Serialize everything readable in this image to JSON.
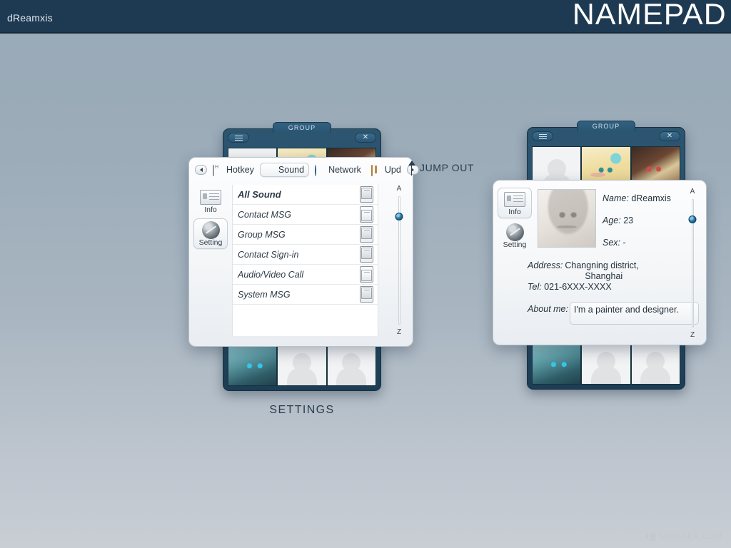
{
  "header": {
    "user": "dReamxis",
    "brand": "NAMEPAD"
  },
  "group_window_left": {
    "tab_label": "GROUP",
    "menu_icon": "hamburger-icon",
    "close_icon": "close-icon",
    "top_avatars": [
      "placeholder-avatar",
      "blonde-anime-avatar",
      "red-eyes-anime-avatar"
    ],
    "bottom_avatars": [
      "teal-hair-anime-avatar",
      "placeholder-avatar",
      "placeholder-avatar"
    ]
  },
  "group_window_right": {
    "tab_label": "GROUP",
    "menu_icon": "hamburger-icon",
    "close_icon": "close-icon",
    "top_avatars": [
      "placeholder-avatar",
      "blonde-anime-avatar",
      "red-eyes-anime-avatar"
    ],
    "bottom_avatars": [
      "teal-hair-anime-avatar",
      "placeholder-avatar",
      "placeholder-avatar"
    ]
  },
  "settings_panel": {
    "tabs": [
      {
        "label": "Hotkey",
        "icon": "keyboard-key-icon",
        "selected": false
      },
      {
        "label": "Sound",
        "icon": "speaker-icon",
        "selected": true
      },
      {
        "label": "Network",
        "icon": "globe-icon",
        "selected": false
      },
      {
        "label": "Upd",
        "icon": "package-box-icon",
        "selected": false
      }
    ],
    "scroll_left_icon": "arrow-left-icon",
    "scroll_right_icon": "arrow-right-icon",
    "sidebar": [
      {
        "label": "Info",
        "icon": "id-card-icon",
        "selected": false
      },
      {
        "label": "Setting",
        "icon": "gear-icon",
        "selected": true
      }
    ],
    "sound_rows": [
      {
        "label": "All Sound",
        "state": "on"
      },
      {
        "label": "Contact MSG",
        "state": "off"
      },
      {
        "label": "Group MSG",
        "state": "on"
      },
      {
        "label": "Contact Sign-in",
        "state": "on"
      },
      {
        "label": "Audio/Video Call",
        "state": "off"
      },
      {
        "label": "System MSG",
        "state": "on"
      }
    ],
    "alpha_slider": {
      "top_label": "A",
      "bottom_label": "Z"
    }
  },
  "info_panel": {
    "sidebar": [
      {
        "label": "Info",
        "icon": "id-card-icon",
        "selected": true
      },
      {
        "label": "Setting",
        "icon": "gear-icon",
        "selected": false
      }
    ],
    "photo": "pencil-sketch-portrait",
    "fields": [
      {
        "key": "Name:",
        "value": "dReamxis"
      },
      {
        "key": "Age:",
        "value": "23"
      },
      {
        "key": "Sex:",
        "value": "-"
      }
    ],
    "address_key": "Address:",
    "address_line1": "Changning district,",
    "address_line2": "Shanghai",
    "tel_key": "Tel:",
    "tel_value": "021-6XXX-XXXX",
    "about_key": "About me:",
    "about_value": "I'm a painter and designer.",
    "alpha_slider": {
      "top_label": "A",
      "bottom_label": "Z"
    }
  },
  "annotations": {
    "jump_out": "JUMP OUT",
    "settings_caption": "SETTINGS"
  },
  "watermark": {
    "text": "UIMAKER.COM"
  },
  "colors": {
    "header_bg": "#1e3a52",
    "page_bg_top": "#98a9b7",
    "page_bg_bottom": "#c9ced5",
    "window_chrome": "#2c5570",
    "accent_knob": "#2b7ca8"
  }
}
